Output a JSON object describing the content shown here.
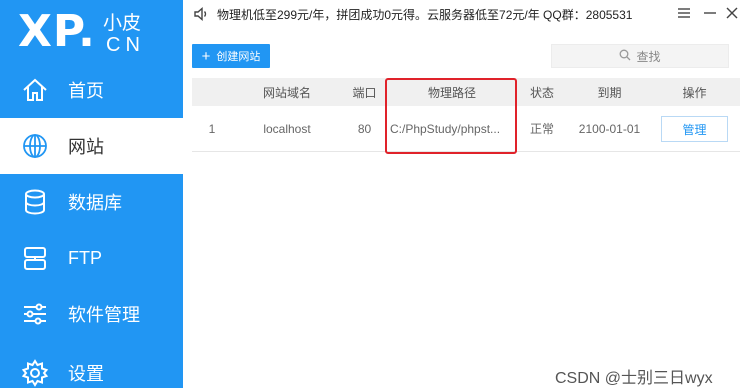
{
  "logo": {
    "big": "XP.",
    "small": "小皮",
    "cn": "CN"
  },
  "sidebar": {
    "items": [
      {
        "label": "首页",
        "icon": "home-icon"
      },
      {
        "label": "网站",
        "icon": "globe-icon",
        "active": true
      },
      {
        "label": "数据库",
        "icon": "database-icon"
      },
      {
        "label": "FTP",
        "icon": "server-icon"
      },
      {
        "label": "软件管理",
        "icon": "sliders-icon"
      },
      {
        "label": "设置",
        "icon": "gear-icon"
      }
    ]
  },
  "topbar": {
    "notice": "物理机低至299元/年，拼团成功0元得。云服务器低至72元/年  QQ群：2805531",
    "icons": [
      "speaker-icon",
      "menu-icon",
      "minimize-icon",
      "close-icon"
    ]
  },
  "toolbar": {
    "create_label": "创建网站",
    "search_placeholder": "查找"
  },
  "table": {
    "columns": [
      "网站域名",
      "端口",
      "物理路径",
      "状态",
      "到期",
      "操作"
    ],
    "rows": [
      {
        "index": "1",
        "domain": "localhost",
        "port": "80",
        "path": "C:/PhpStudy/phpst...",
        "status": "正常",
        "expiry": "2100-01-01",
        "action": "管理"
      }
    ]
  },
  "colors": {
    "accent": "#2196f3",
    "highlight": "#e0222a"
  },
  "watermark": "CSDN @士别三日wyx"
}
